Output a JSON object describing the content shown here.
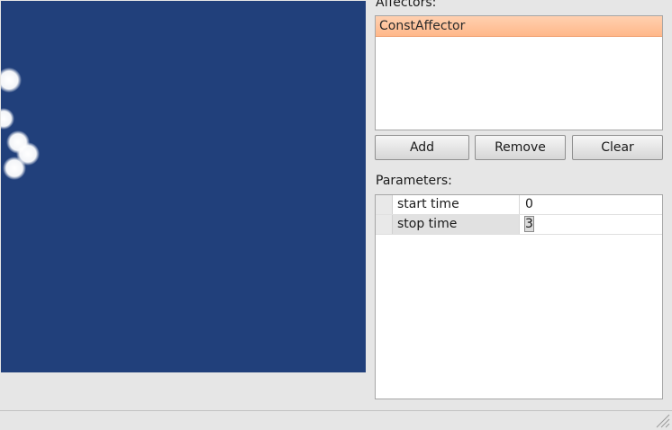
{
  "affectors": {
    "label": "Affectors:",
    "items": [
      {
        "label": "ConstAffector",
        "selected": true
      }
    ]
  },
  "buttons": {
    "add": "Add",
    "remove": "Remove",
    "clear": "Clear"
  },
  "parameters": {
    "label": "Parameters:",
    "rows": [
      {
        "name": "start time",
        "value": "0"
      },
      {
        "name": "stop time",
        "value": "3"
      }
    ]
  },
  "colors": {
    "viewport_background": "#21407b",
    "selection": "#ffb88a",
    "particle": "#ffffff"
  }
}
